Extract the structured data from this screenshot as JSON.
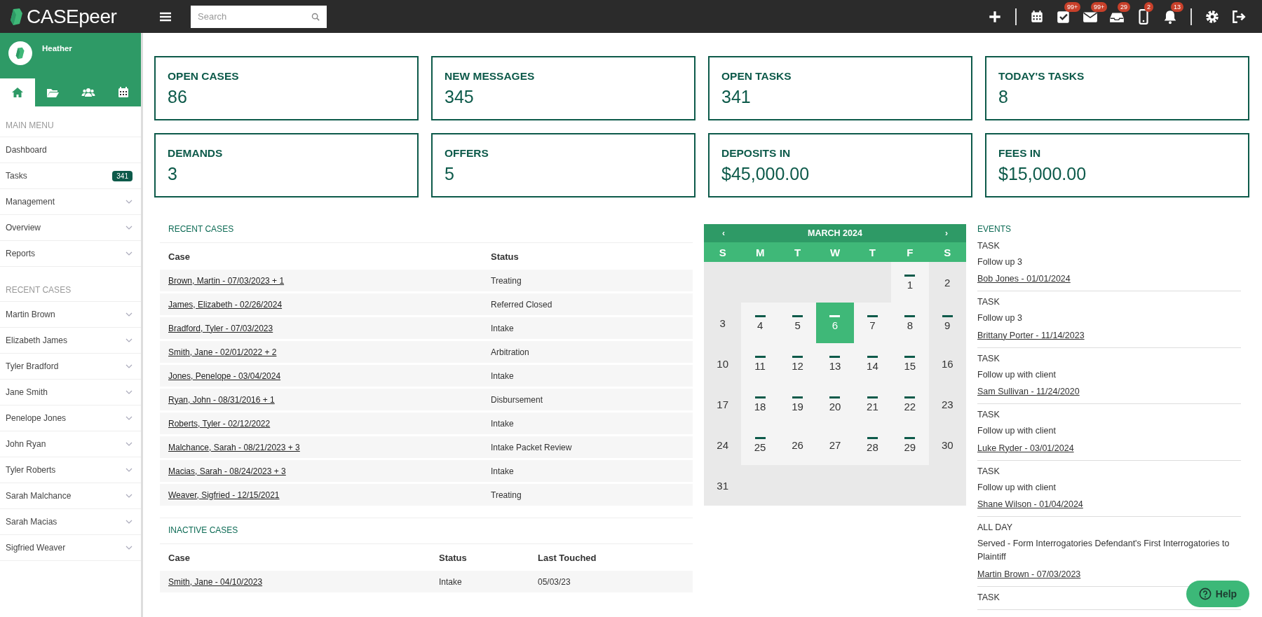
{
  "topbar": {
    "logo": "CASEpeer",
    "search": {
      "placeholder": "Search"
    },
    "actions": [
      {
        "kind": "plus"
      }
    ],
    "notifications": [
      {
        "kind": "calendar"
      },
      {
        "kind": "check",
        "badge": "99+"
      },
      {
        "kind": "mail",
        "badge": "99+"
      },
      {
        "kind": "inbox",
        "badge": "29"
      },
      {
        "kind": "phone",
        "badge": "2"
      },
      {
        "kind": "bell",
        "badge": "13"
      }
    ],
    "system": [
      {
        "kind": "gear"
      },
      {
        "kind": "logout"
      }
    ]
  },
  "sidebar": {
    "user": "Heather",
    "tabs": [
      {
        "kind": "home",
        "selected": true
      },
      {
        "kind": "folder",
        "selected": false
      },
      {
        "kind": "users",
        "selected": false
      },
      {
        "kind": "calendar",
        "selected": false
      }
    ],
    "main_menu": {
      "heading": "MAIN MENU",
      "items": [
        {
          "label": "Dashboard",
          "kind": "link"
        },
        {
          "label": "Tasks",
          "kind": "badge",
          "badge": "341"
        },
        {
          "label": "Management",
          "kind": "dropdown"
        },
        {
          "label": "Overview",
          "kind": "dropdown"
        },
        {
          "label": "Reports",
          "kind": "dropdown"
        }
      ]
    },
    "recent_cases": {
      "heading": "RECENT CASES",
      "items": [
        "Martin Brown",
        "Elizabeth James",
        "Tyler Bradford",
        "Jane Smith",
        "Penelope Jones",
        "John Ryan",
        "Tyler Roberts",
        "Sarah Malchance",
        "Sarah Macias",
        "Sigfried Weaver"
      ]
    }
  },
  "stats": [
    {
      "label": "OPEN CASES",
      "value": "86"
    },
    {
      "label": "NEW MESSAGES",
      "value": "345"
    },
    {
      "label": "OPEN TASKS",
      "value": "341"
    },
    {
      "label": "TODAY'S TASKS",
      "value": "8"
    },
    {
      "label": "DEMANDS",
      "value": "3"
    },
    {
      "label": "OFFERS",
      "value": "5"
    },
    {
      "label": "DEPOSITS IN",
      "value": "$45,000.00"
    },
    {
      "label": "FEES IN",
      "value": "$15,000.00"
    }
  ],
  "recent_cases": {
    "title": "RECENT CASES",
    "columns": [
      "Case",
      "Status"
    ],
    "rows": [
      [
        "Brown, Martin - 07/03/2023 + 1",
        "Treating"
      ],
      [
        "James, Elizabeth - 02/26/2024",
        "Referred Closed"
      ],
      [
        "Bradford, Tyler - 07/03/2023",
        "Intake"
      ],
      [
        "Smith, Jane - 02/01/2022 + 2",
        "Arbitration"
      ],
      [
        "Jones, Penelope - 03/04/2024",
        "Intake"
      ],
      [
        "Ryan, John - 08/31/2016 + 1",
        "Disbursement"
      ],
      [
        "Roberts, Tyler - 02/12/2022",
        "Intake"
      ],
      [
        "Malchance, Sarah - 08/21/2023 + 3",
        "Intake Packet Review"
      ],
      [
        "Macias, Sarah - 08/24/2023 + 3",
        "Intake"
      ],
      [
        "Weaver, Sigfried - 12/15/2021",
        "Treating"
      ]
    ]
  },
  "inactive_cases": {
    "title": "INACTIVE CASES",
    "columns": [
      "Case",
      "Status",
      "Last Touched"
    ],
    "rows": [
      [
        "Smith, Jane - 04/10/2023",
        "Intake",
        "05/03/23"
      ]
    ]
  },
  "calendar": {
    "prev": "‹",
    "title": "MARCH 2024",
    "next": "›",
    "weekdays": [
      "S",
      "M",
      "T",
      "W",
      "T",
      "F",
      "S"
    ],
    "weeks": [
      [
        {
          "kind": "blank"
        },
        {
          "kind": "blank"
        },
        {
          "kind": "blank"
        },
        {
          "kind": "blank"
        },
        {
          "kind": "blank"
        },
        {
          "kind": "day",
          "day": "1",
          "event": true,
          "selected": false
        },
        {
          "kind": "day",
          "day": "2",
          "event": false,
          "selected": false
        }
      ],
      [
        {
          "kind": "day",
          "day": "3",
          "event": false,
          "selected": false
        },
        {
          "kind": "day",
          "day": "4",
          "event": true,
          "selected": false
        },
        {
          "kind": "day",
          "day": "5",
          "event": true,
          "selected": false
        },
        {
          "kind": "day",
          "day": "6",
          "event": true,
          "selected": true
        },
        {
          "kind": "day",
          "day": "7",
          "event": true,
          "selected": false
        },
        {
          "kind": "day",
          "day": "8",
          "event": true,
          "selected": false
        },
        {
          "kind": "day",
          "day": "9",
          "event": true,
          "selected": false
        }
      ],
      [
        {
          "kind": "day",
          "day": "10",
          "event": false,
          "selected": false
        },
        {
          "kind": "day",
          "day": "11",
          "event": true,
          "selected": false
        },
        {
          "kind": "day",
          "day": "12",
          "event": true,
          "selected": false
        },
        {
          "kind": "day",
          "day": "13",
          "event": true,
          "selected": false
        },
        {
          "kind": "day",
          "day": "14",
          "event": true,
          "selected": false
        },
        {
          "kind": "day",
          "day": "15",
          "event": true,
          "selected": false
        },
        {
          "kind": "day",
          "day": "16",
          "event": false,
          "selected": false
        }
      ],
      [
        {
          "kind": "day",
          "day": "17",
          "event": false,
          "selected": false
        },
        {
          "kind": "day",
          "day": "18",
          "event": true,
          "selected": false
        },
        {
          "kind": "day",
          "day": "19",
          "event": true,
          "selected": false
        },
        {
          "kind": "day",
          "day": "20",
          "event": true,
          "selected": false
        },
        {
          "kind": "day",
          "day": "21",
          "event": true,
          "selected": false
        },
        {
          "kind": "day",
          "day": "22",
          "event": true,
          "selected": false
        },
        {
          "kind": "day",
          "day": "23",
          "event": false,
          "selected": false
        }
      ],
      [
        {
          "kind": "day",
          "day": "24",
          "event": false,
          "selected": false
        },
        {
          "kind": "day",
          "day": "25",
          "event": true,
          "selected": false
        },
        {
          "kind": "day",
          "day": "26",
          "event": false,
          "selected": false
        },
        {
          "kind": "day",
          "day": "27",
          "event": false,
          "selected": false
        },
        {
          "kind": "day",
          "day": "28",
          "event": true,
          "selected": false
        },
        {
          "kind": "day",
          "day": "29",
          "event": true,
          "selected": false
        },
        {
          "kind": "day",
          "day": "30",
          "event": false,
          "selected": false
        }
      ],
      [
        {
          "kind": "day",
          "day": "31",
          "event": false,
          "selected": false
        },
        {
          "kind": "blank"
        },
        {
          "kind": "blank"
        },
        {
          "kind": "blank"
        },
        {
          "kind": "blank"
        },
        {
          "kind": "blank"
        },
        {
          "kind": "blank"
        }
      ]
    ]
  },
  "events": {
    "title": "EVENTS",
    "items": [
      {
        "type": "TASK",
        "title": "Follow up 3",
        "link": "Bob Jones - 01/01/2024"
      },
      {
        "type": "TASK",
        "title": "Follow up 3",
        "link": "Brittany Porter - 11/14/2023"
      },
      {
        "type": "TASK",
        "title": "Follow up with client",
        "link": "Sam Sullivan - 11/24/2020"
      },
      {
        "type": "TASK",
        "title": "Follow up with client",
        "link": "Luke Ryder - 03/01/2024"
      },
      {
        "type": "TASK",
        "title": "Follow up with client",
        "link": "Shane Wilson - 01/04/2024"
      },
      {
        "type": "ALL DAY",
        "title": "Served - Form Interrogatories Defendant's First Interrogatories to Plaintiff",
        "link": "Martin Brown - 07/03/2023"
      },
      {
        "type": "TASK"
      }
    ]
  },
  "help": {
    "label": "Help"
  }
}
